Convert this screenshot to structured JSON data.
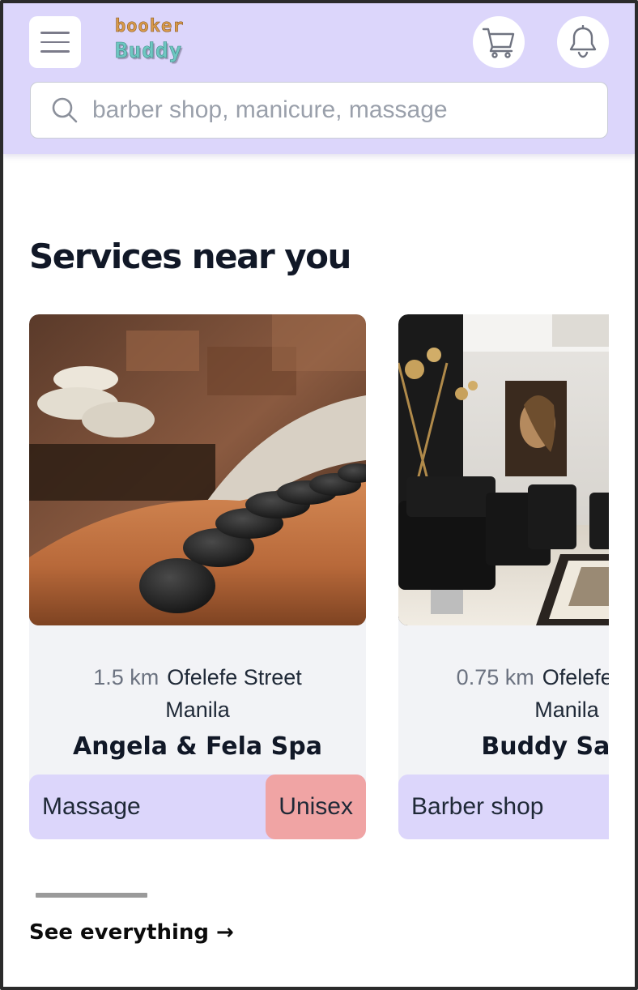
{
  "header": {
    "logo_line1": "booker",
    "logo_line2": "Buddy",
    "search": {
      "placeholder": "barber shop, manicure, massage",
      "value": ""
    },
    "icons": [
      "menu-icon",
      "cart-icon",
      "bell-icon",
      "search-icon"
    ]
  },
  "section": {
    "title": "Services near you"
  },
  "cards": [
    {
      "distance": "1.5 km",
      "street": "Ofelefe Street",
      "city": "Manila",
      "name": "Angela & Fela Spa",
      "category": "Massage",
      "gender": "Unisex"
    },
    {
      "distance": "0.75 km",
      "street": "Ofelefe Street",
      "city": "Manila",
      "name": "Buddy Salon",
      "category": "Barber shop"
    }
  ],
  "footer": {
    "see_all": "See everything →"
  },
  "colors": {
    "header_bg": "#dcd6fb",
    "tag_bg": "#dcd6fb",
    "gender_tag_bg": "#f0a4a4",
    "card_bg": "#f2f3f6"
  }
}
